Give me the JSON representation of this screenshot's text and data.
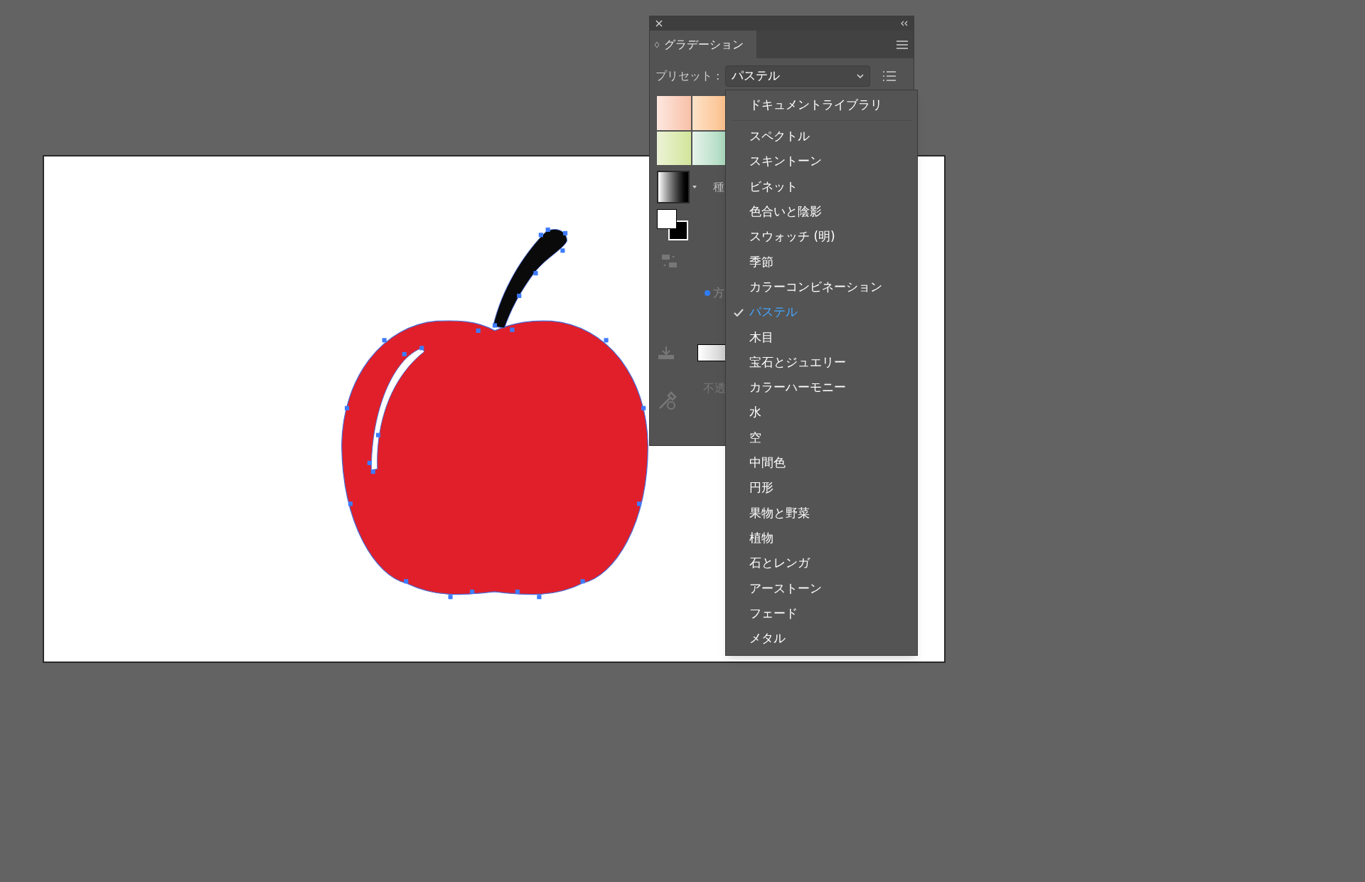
{
  "panel": {
    "tab": "グラデーション",
    "preset_label": "プリセット :",
    "preset_value": "パステル",
    "type_label": "種",
    "direction_label": "方",
    "opacity_label": "不透"
  },
  "menu": {
    "items": [
      {
        "label": "ドキュメントライブラリ",
        "selected": false
      },
      {
        "label": "スペクトル",
        "selected": false
      },
      {
        "label": "スキントーン",
        "selected": false
      },
      {
        "label": "ビネット",
        "selected": false
      },
      {
        "label": "色合いと陰影",
        "selected": false
      },
      {
        "label": "スウォッチ (明)",
        "selected": false
      },
      {
        "label": "季節",
        "selected": false
      },
      {
        "label": "カラーコンビネーション",
        "selected": false
      },
      {
        "label": "パステル",
        "selected": true
      },
      {
        "label": "木目",
        "selected": false
      },
      {
        "label": "宝石とジュエリー",
        "selected": false
      },
      {
        "label": "カラーハーモニー",
        "selected": false
      },
      {
        "label": "水",
        "selected": false
      },
      {
        "label": "空",
        "selected": false
      },
      {
        "label": "中間色",
        "selected": false
      },
      {
        "label": "円形",
        "selected": false
      },
      {
        "label": "果物と野菜",
        "selected": false
      },
      {
        "label": "植物",
        "selected": false
      },
      {
        "label": "石とレンガ",
        "selected": false
      },
      {
        "label": "アーストーン",
        "selected": false
      },
      {
        "label": "フェード",
        "selected": false
      },
      {
        "label": "メタル",
        "selected": false
      }
    ]
  }
}
